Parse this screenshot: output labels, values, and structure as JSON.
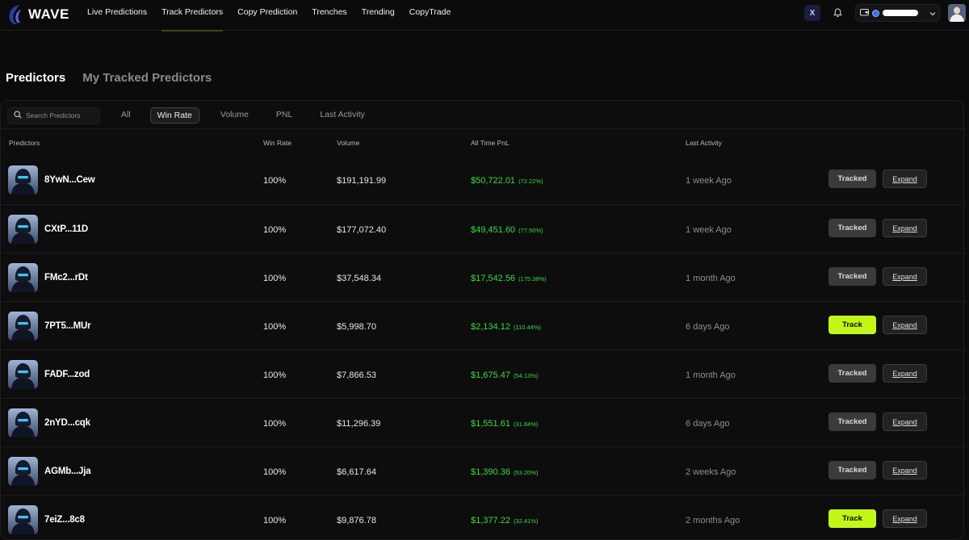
{
  "header": {
    "brand": "WAVE",
    "nav": [
      {
        "label": "Live Predictions",
        "active": false
      },
      {
        "label": "Track Predictors",
        "active": true
      },
      {
        "label": "Copy Prediction",
        "active": false
      },
      {
        "label": "Trenches",
        "active": false
      },
      {
        "label": "Trending",
        "active": false
      },
      {
        "label": "CopyTrade",
        "active": false
      }
    ],
    "x_label": "X"
  },
  "page_tabs": [
    {
      "label": "Predictors",
      "active": true
    },
    {
      "label": "My Tracked Predictors",
      "active": false
    }
  ],
  "search": {
    "placeholder": "Search Predictors"
  },
  "filters": [
    {
      "label": "All",
      "active": false
    },
    {
      "label": "Win Rate",
      "active": true
    },
    {
      "label": "Volume",
      "active": false
    },
    {
      "label": "PNL",
      "active": false
    },
    {
      "label": "Last Activity",
      "active": false
    }
  ],
  "columns": [
    "Predictors",
    "Win Rate",
    "Volume",
    "All Time PnL",
    "Last Activity"
  ],
  "expand_label": "Expand",
  "rows": [
    {
      "name": "8YwN...Cew",
      "win_rate": "100%",
      "volume": "$191,191.99",
      "pnl": "$50,722.01",
      "pnl_pct": "(72.22%)",
      "last_activity": "1 week Ago",
      "track_label": "Tracked"
    },
    {
      "name": "CXtP...11D",
      "win_rate": "100%",
      "volume": "$177,072.40",
      "pnl": "$49,451.60",
      "pnl_pct": "(77.50%)",
      "last_activity": "1 week Ago",
      "track_label": "Tracked"
    },
    {
      "name": "FMc2...rDt",
      "win_rate": "100%",
      "volume": "$37,548.34",
      "pnl": "$17,542.56",
      "pnl_pct": "(175.38%)",
      "last_activity": "1 month Ago",
      "track_label": "Tracked"
    },
    {
      "name": "7PT5...MUr",
      "win_rate": "100%",
      "volume": "$5,998.70",
      "pnl": "$2,134.12",
      "pnl_pct": "(110.44%)",
      "last_activity": "6 days Ago",
      "track_label": "Track"
    },
    {
      "name": "FADF...zod",
      "win_rate": "100%",
      "volume": "$7,866.53",
      "pnl": "$1,675.47",
      "pnl_pct": "(54.13%)",
      "last_activity": "1 month Ago",
      "track_label": "Tracked"
    },
    {
      "name": "2nYD...cqk",
      "win_rate": "100%",
      "volume": "$11,296.39",
      "pnl": "$1,551.61",
      "pnl_pct": "(31.84%)",
      "last_activity": "6 days Ago",
      "track_label": "Tracked"
    },
    {
      "name": "AGMb...Jja",
      "win_rate": "100%",
      "volume": "$6,617.64",
      "pnl": "$1,390.36",
      "pnl_pct": "(53.20%)",
      "last_activity": "2 weeks Ago",
      "track_label": "Tracked"
    },
    {
      "name": "7eiZ...8c8",
      "win_rate": "100%",
      "volume": "$9,876.78",
      "pnl": "$1,377.22",
      "pnl_pct": "(32.41%)",
      "last_activity": "2 months Ago",
      "track_label": "Track"
    }
  ],
  "colors": {
    "accent": "#c2f518",
    "positive": "#3bdc3b",
    "background": "#0b0b0c"
  },
  "icons": [
    "wave-logo-icon",
    "x-icon",
    "bell-icon",
    "wallet-icon",
    "chevron-down-icon",
    "search-icon",
    "avatar"
  ]
}
